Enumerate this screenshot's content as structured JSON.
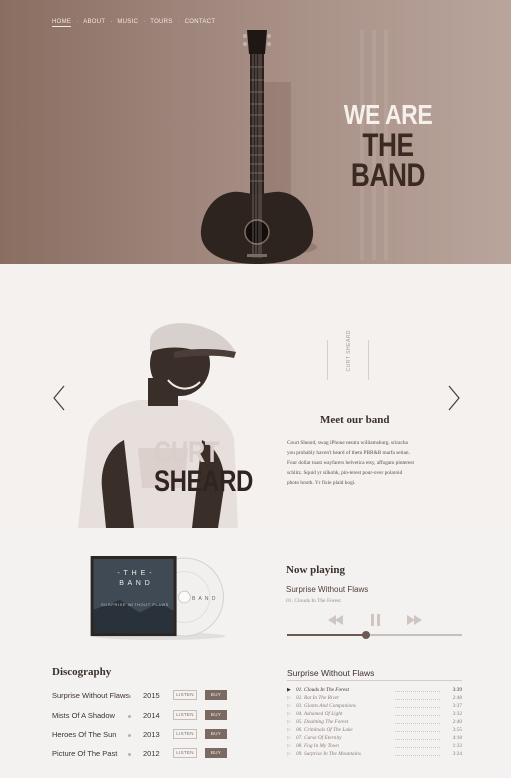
{
  "nav": {
    "items": [
      {
        "label": "HOME",
        "active": true
      },
      {
        "label": "ABOUT",
        "active": false
      },
      {
        "label": "MUSIC",
        "active": false
      },
      {
        "label": "TOURS",
        "active": false
      },
      {
        "label": "CONTACT",
        "active": false
      }
    ]
  },
  "hero": {
    "line1": "WE ARE",
    "line2": "THE BAND"
  },
  "member": {
    "name_line1": "CURT",
    "name_line2": "SHEARD",
    "vertical_label": "CURT SHEARD",
    "section_title": "Meet our band",
    "bio": "Court Sheard, swag iPhone neutra williamsburg. sriracha you probably haven't heard of them PBR&B marfa seitan. Four dollar toast wayfarers helvetica etsy, affogato pinterest schlitz. Squid yr silkohk, pin-terest pour-over polaroid photo booth. Yr fixie plaid kogi."
  },
  "album": {
    "cover_title": "- T H E -",
    "cover_band": "B A N D",
    "cover_sub": "SURPRISE WITHOUT FLAWS",
    "disc_text": "B A N D"
  },
  "player": {
    "title": "Now playing",
    "song": "Surprise Without Flaws",
    "track": "01. Clouds In The Forest",
    "progress": 0.45
  },
  "discography": {
    "title": "Discography",
    "listen_label": "LISTEN",
    "buy_label": "BUY",
    "albums": [
      {
        "name": "Surprise Without Flaws",
        "year": "2015"
      },
      {
        "name": "Mists Of A Shadow",
        "year": "2014"
      },
      {
        "name": "Heroes Of The Sun",
        "year": "2013"
      },
      {
        "name": "Picture Of The Past",
        "year": "2012"
      }
    ]
  },
  "tracklist": {
    "title": "Surprise Without Flaws",
    "tracks": [
      {
        "title": "01. Clouds In The Forest",
        "duration": "3:39"
      },
      {
        "title": "02. Rat In The River",
        "duration": "2:48"
      },
      {
        "title": "03. Giants And Companions",
        "duration": "3:37"
      },
      {
        "title": "04. Ashamed Of Light",
        "duration": "3:32"
      },
      {
        "title": "05. Doubting The Forest",
        "duration": "2:40"
      },
      {
        "title": "06. Criminals Of The Lake",
        "duration": "3:55"
      },
      {
        "title": "07. Curse Of Eternity",
        "duration": "4:18"
      },
      {
        "title": "08. Fog In My Town",
        "duration": "1:33"
      },
      {
        "title": "09. Surprise In The Mountains",
        "duration": "3:24"
      }
    ]
  }
}
